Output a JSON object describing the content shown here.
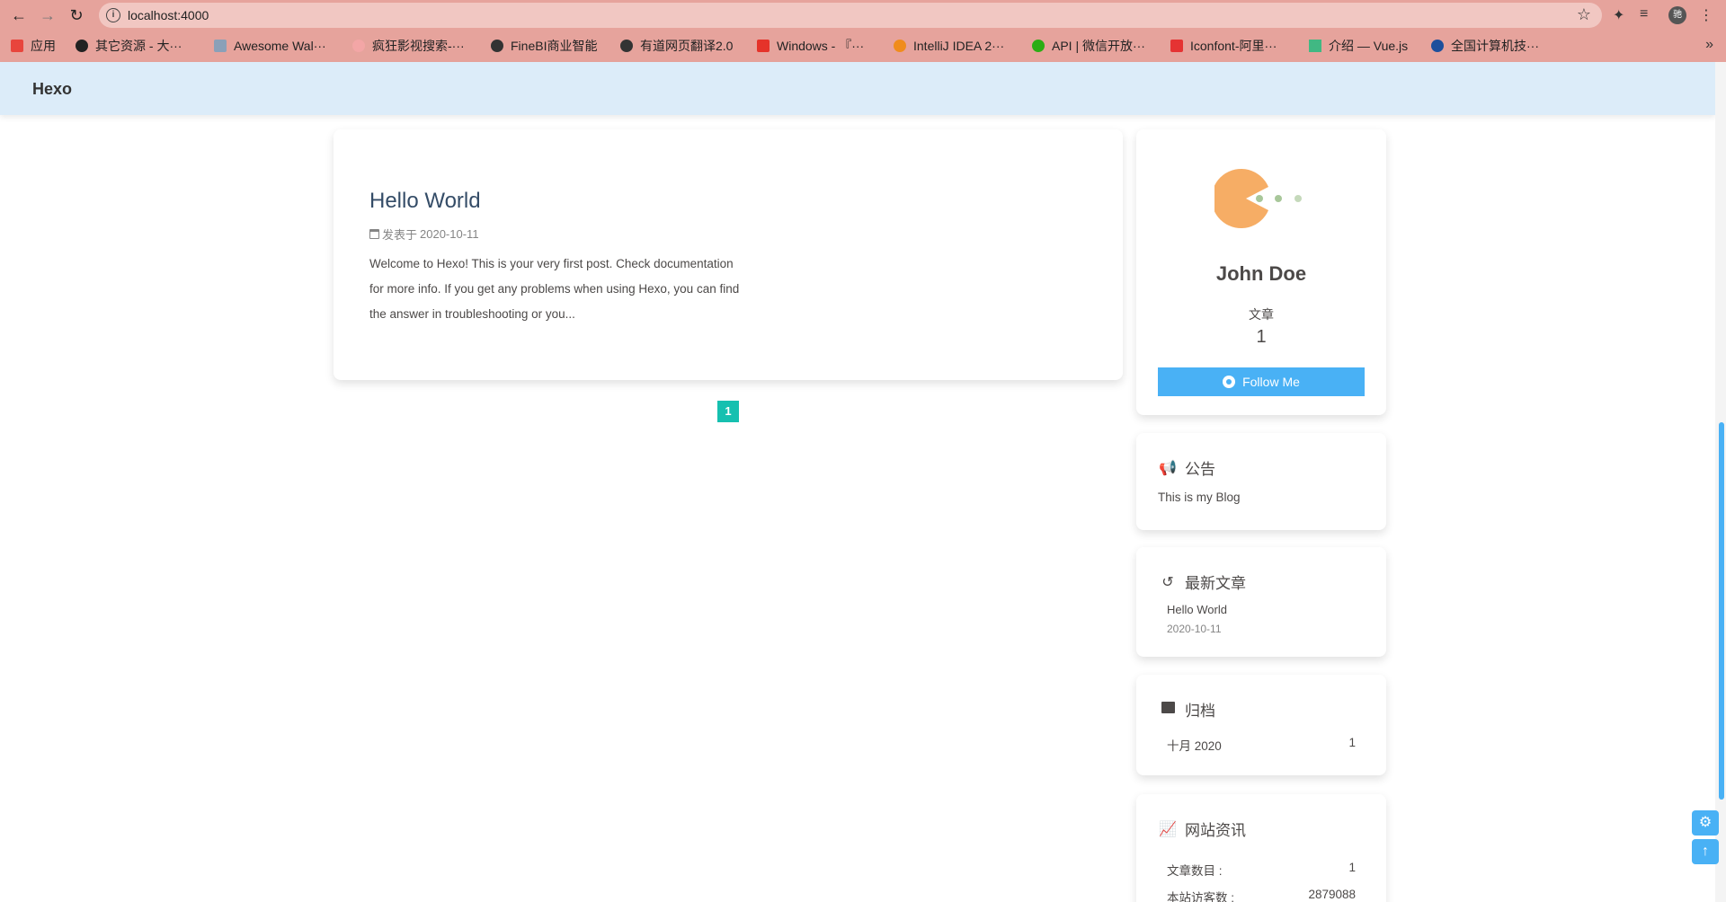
{
  "browser": {
    "url": "localhost:4000",
    "profile_initial": "驰",
    "bookmarks": [
      {
        "label": "应用",
        "color": "#e8453c"
      },
      {
        "label": "其它资源 - 大···",
        "color": "#222222"
      },
      {
        "label": "Awesome Wal···",
        "color": "#8aa0b8"
      },
      {
        "label": "疯狂影视搜索-···",
        "color": "#f3a6a6"
      },
      {
        "label": "FineBI商业智能",
        "color": "#333333"
      },
      {
        "label": "有道网页翻译2.0",
        "color": "#333333"
      },
      {
        "label": "Windows - 『···",
        "color": "#e5332a"
      },
      {
        "label": "IntelliJ IDEA 2···",
        "color": "#f08c1c"
      },
      {
        "label": "API | 微信开放···",
        "color": "#2bad14"
      },
      {
        "label": "Iconfont-阿里···",
        "color": "#e53333"
      },
      {
        "label": "介绍 — Vue.js",
        "color": "#41b883"
      },
      {
        "label": "全国计算机技···",
        "color": "#1d4f9c"
      }
    ],
    "more_label": "»"
  },
  "header": {
    "site_name": "Hexo"
  },
  "post": {
    "title": "Hello World",
    "meta_prefix": "发表于",
    "date": "2020-10-11",
    "excerpt": "Welcome to Hexo! This is your very first post. Check documentation for more info. If you get any problems when using Hexo, you can find the answer in troubleshooting or you..."
  },
  "pagination": {
    "current": "1"
  },
  "author": {
    "name": "John Doe",
    "articles_label": "文章",
    "articles_count": "1",
    "follow_label": "Follow Me"
  },
  "notice": {
    "title": "公告",
    "text": "This is my Blog"
  },
  "recent": {
    "title": "最新文章",
    "items": [
      {
        "title": "Hello World",
        "date": "2020-10-11"
      }
    ]
  },
  "archive": {
    "title": "归档",
    "items": [
      {
        "label": "十月 2020",
        "count": "1"
      }
    ]
  },
  "site_info": {
    "title": "网站资讯",
    "rows": [
      {
        "label": "文章数目 :",
        "value": "1"
      },
      {
        "label": "本站访客数 :",
        "value": "2879088"
      }
    ]
  },
  "colors": {
    "accent": "#49b1f5",
    "pagination": "#16c0b0",
    "header_bg": "#dcecf9",
    "chrome_bg": "#e6a39c",
    "notice_icon": "#e5332a"
  }
}
